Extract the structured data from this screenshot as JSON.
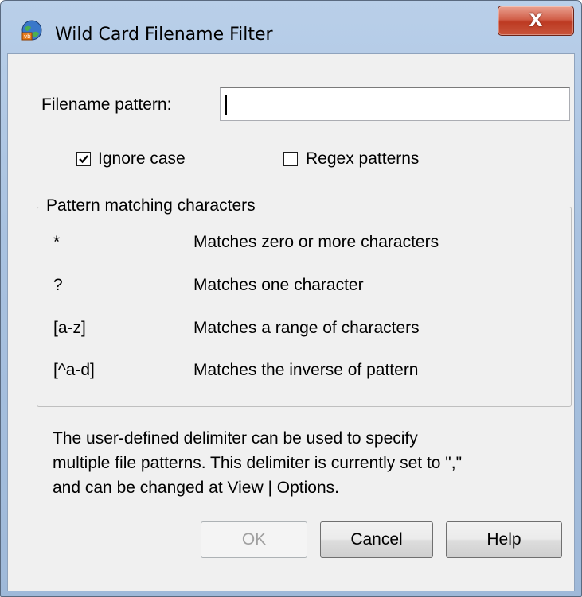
{
  "window": {
    "title": "Wild Card Filename Filter",
    "close_glyph": "X",
    "app_icon": "globe-app-icon"
  },
  "form": {
    "filename_label": "Filename pattern:",
    "filename_value": "",
    "ignore_case": {
      "label": "Ignore case",
      "checked": true
    },
    "regex": {
      "label": "Regex patterns",
      "checked": false
    }
  },
  "group": {
    "title": "Pattern matching characters",
    "rows": [
      {
        "symbol": "*",
        "description": "Matches zero or more characters"
      },
      {
        "symbol": "?",
        "description": "Matches one character"
      },
      {
        "symbol": "[a-z]",
        "description": "Matches a range of characters"
      },
      {
        "symbol": "[^a-d]",
        "description": "Matches the inverse of pattern"
      }
    ]
  },
  "info": {
    "lines": [
      "The user-defined delimiter can be used to specify",
      "multiple file patterns. This delimiter is currently set to \",\"",
      "and can be changed at View | Options."
    ]
  },
  "buttons": {
    "ok": {
      "label": "OK",
      "enabled": false
    },
    "cancel": {
      "label": "Cancel",
      "enabled": true
    },
    "help": {
      "label": "Help",
      "enabled": true
    }
  },
  "colors": {
    "title_bar": "#b9cfe9",
    "close_button": "#c8553c",
    "dialog_background": "#f0f0f0"
  }
}
